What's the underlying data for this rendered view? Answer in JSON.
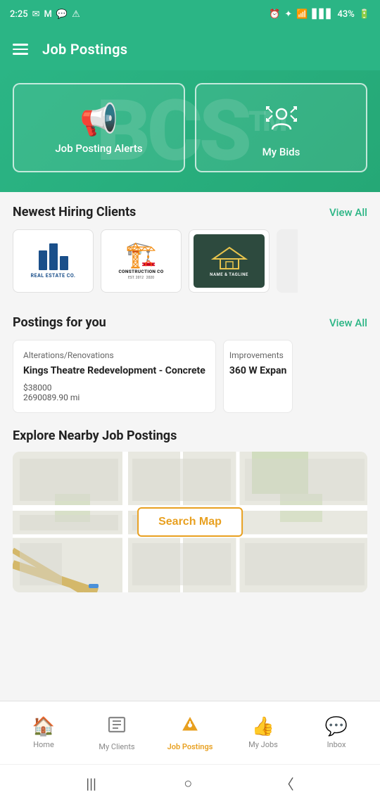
{
  "statusBar": {
    "time": "2:25",
    "battery": "43%",
    "icons": [
      "msg-icon",
      "mail-icon",
      "chat-icon",
      "alert-icon",
      "alarm-icon",
      "bluetooth-icon",
      "wifi-icon",
      "signal-icon",
      "battery-icon"
    ]
  },
  "header": {
    "title": "Job Postings",
    "menu_label": "menu"
  },
  "watermark": {
    "text": "BCS",
    "superscript": "TM"
  },
  "heroCards": [
    {
      "id": "job-posting-alerts",
      "icon": "📢",
      "label": "Job Posting Alerts"
    },
    {
      "id": "my-bids",
      "icon": "👤",
      "label": "My Bids"
    }
  ],
  "newestClients": {
    "title": "Newest Hiring Clients",
    "viewAll": "View All",
    "clients": [
      {
        "name": "Real Estate Co",
        "type": "real-estate"
      },
      {
        "name": "Construction Co",
        "type": "construction"
      },
      {
        "name": "Name & Tagline",
        "type": "nametagline"
      }
    ]
  },
  "postingsForYou": {
    "title": "Postings for you",
    "viewAll": "View All",
    "postings": [
      {
        "category": "Alterations/Renovations",
        "title": "Kings Theatre Redevelopment - Concrete",
        "price": "$38000",
        "distance": "2690089.90 mi"
      },
      {
        "category": "Improvements",
        "title": "360 W Expan",
        "price": "",
        "distance": ""
      }
    ]
  },
  "exploreNearby": {
    "title": "Explore Nearby Job Postings",
    "searchMapButton": "Search Map"
  },
  "bottomNav": {
    "items": [
      {
        "id": "home",
        "label": "Home",
        "icon": "🏠",
        "active": false
      },
      {
        "id": "my-clients",
        "label": "My Clients",
        "icon": "🏢",
        "active": false
      },
      {
        "id": "job-postings",
        "label": "Job Postings",
        "icon": "📌",
        "active": true
      },
      {
        "id": "my-jobs",
        "label": "My Jobs",
        "icon": "👍",
        "active": false
      },
      {
        "id": "inbox",
        "label": "Inbox",
        "icon": "💬",
        "active": false
      }
    ]
  },
  "systemNav": {
    "items": [
      "|||",
      "○",
      "<"
    ]
  }
}
